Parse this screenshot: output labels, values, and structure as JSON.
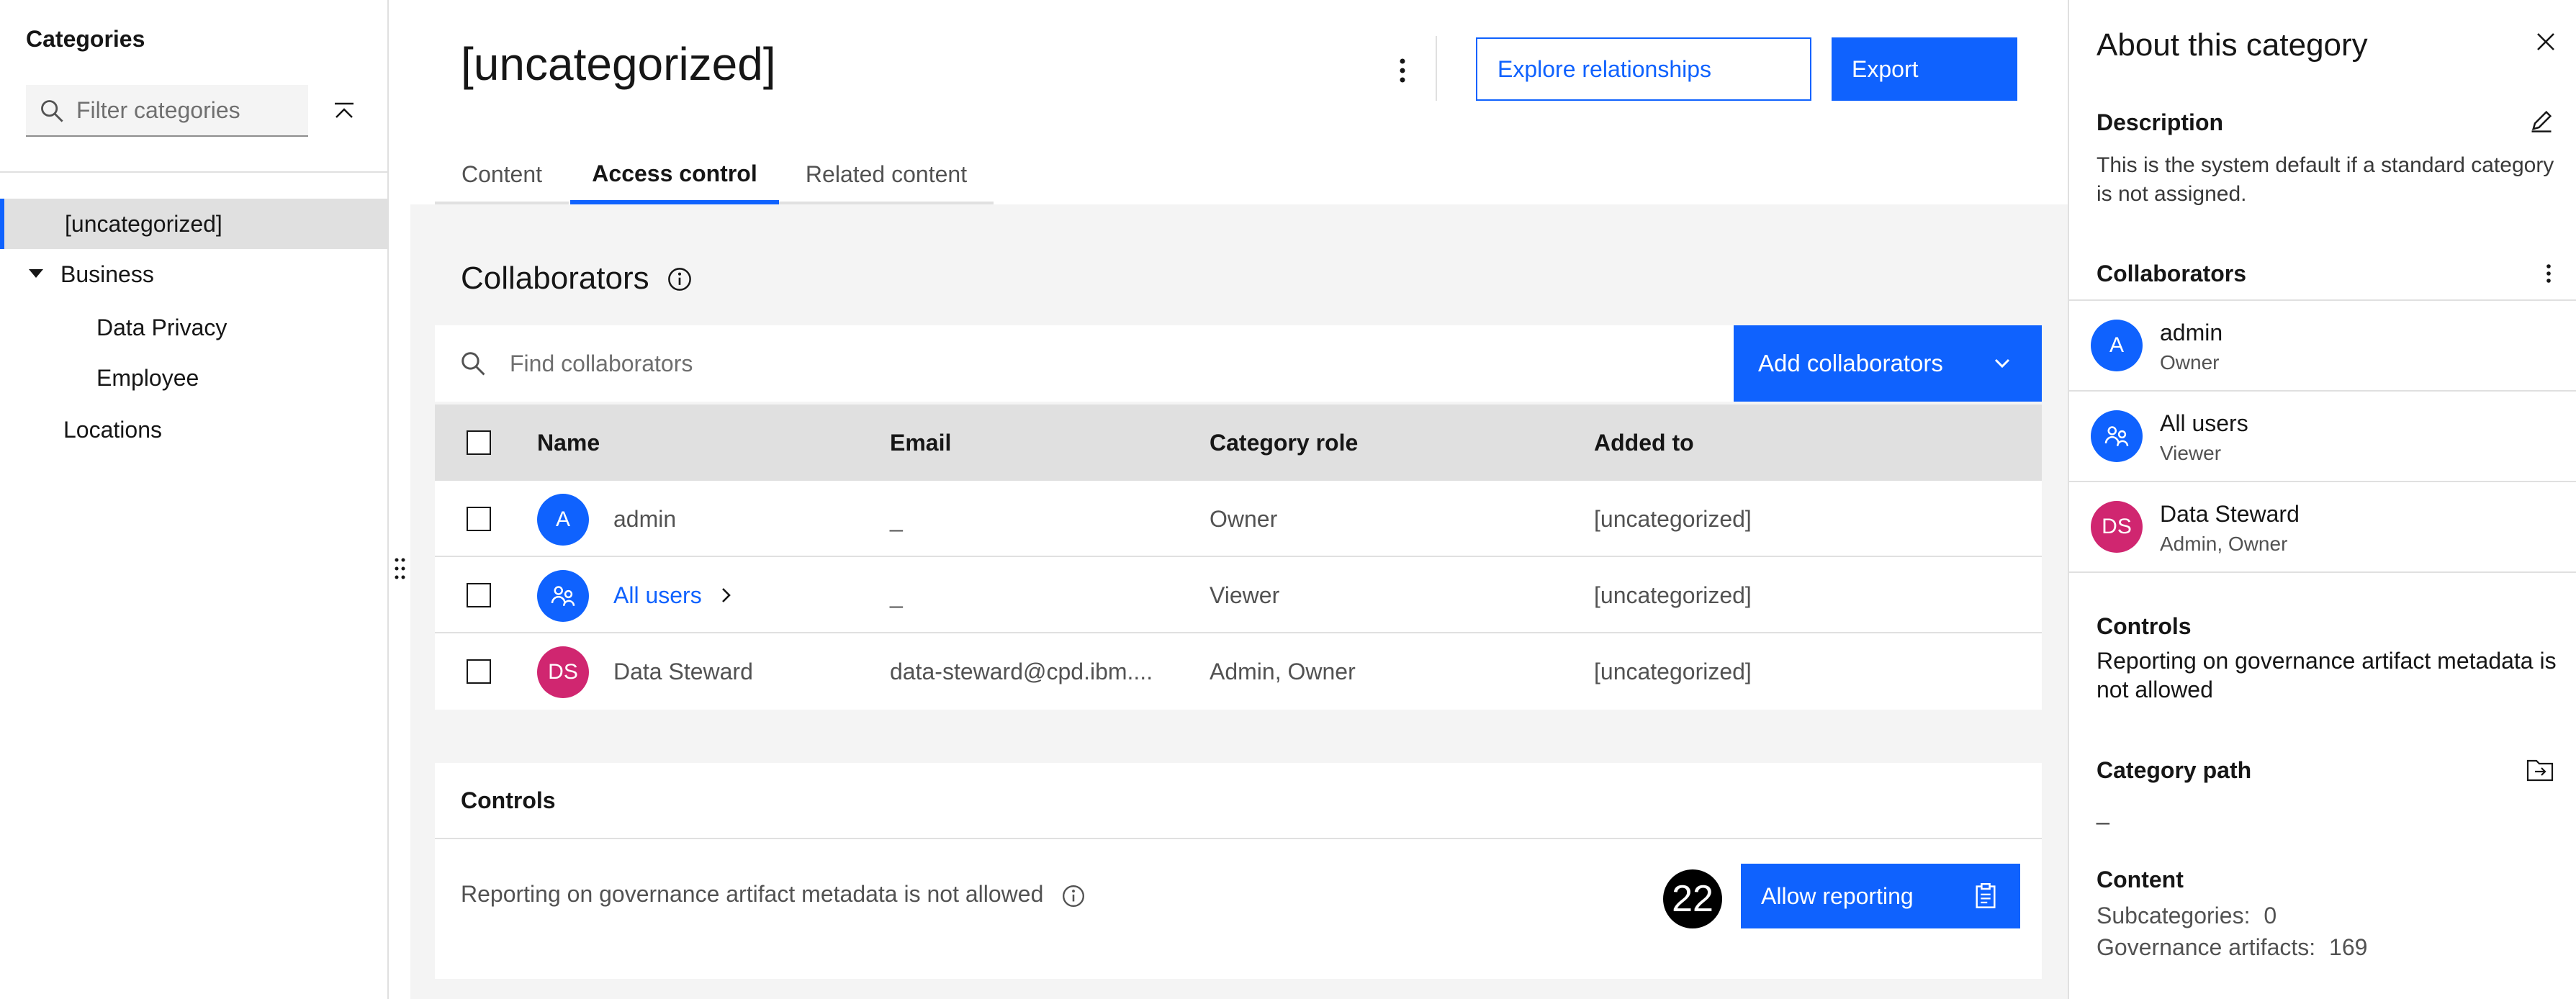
{
  "sidebar": {
    "title": "Categories",
    "filter_placeholder": "Filter categories",
    "tree": [
      {
        "label": "[uncategorized]",
        "selected": true
      },
      {
        "label": "Business",
        "expanded": true
      },
      {
        "label": "Data Privacy"
      },
      {
        "label": "Employee"
      },
      {
        "label": "Locations"
      }
    ]
  },
  "header": {
    "title": "[uncategorized]",
    "explore_label": "Explore relationships",
    "export_label": "Export"
  },
  "tabs": [
    {
      "label": "Content",
      "active": false
    },
    {
      "label": "Access control",
      "active": true
    },
    {
      "label": "Related content",
      "active": false
    }
  ],
  "collaborators": {
    "title": "Collaborators",
    "search_placeholder": "Find collaborators",
    "add_label": "Add collaborators",
    "columns": [
      "Name",
      "Email",
      "Category role",
      "Added to"
    ],
    "rows": [
      {
        "initials": "A",
        "name": "admin",
        "email": "_",
        "role": "Owner",
        "added_to": "[uncategorized]",
        "avatar_color": "#0f62fe",
        "is_link": false
      },
      {
        "initials": "",
        "name": "All users",
        "email": "_",
        "role": "Viewer",
        "added_to": "[uncategorized]",
        "avatar_color": "#0f62fe",
        "is_link": true
      },
      {
        "initials": "DS",
        "name": "Data Steward",
        "email": "data-steward@cpd.ibm....",
        "role": "Admin, Owner",
        "added_to": "[uncategorized]",
        "avatar_color": "#d02670",
        "is_link": false
      }
    ]
  },
  "controls": {
    "title": "Controls",
    "text": "Reporting on governance artifact metadata is not allowed",
    "badge": "22",
    "allow_label": "Allow reporting"
  },
  "panel": {
    "title": "About this category",
    "description_heading": "Description",
    "description_text": "This is the system default if a standard category is not assigned.",
    "collaborators_heading": "Collaborators",
    "collaborators": [
      {
        "initials": "A",
        "name": "admin",
        "role": "Owner",
        "avatar_color": "#0f62fe"
      },
      {
        "initials": "",
        "name": "All users",
        "role": "Viewer",
        "avatar_color": "#0f62fe"
      },
      {
        "initials": "DS",
        "name": "Data Steward",
        "role": "Admin, Owner",
        "avatar_color": "#d02670"
      }
    ],
    "controls_heading": "Controls",
    "controls_text": "Reporting on governance artifact metadata is not allowed",
    "path_heading": "Category path",
    "path_value": "_",
    "content_heading": "Content",
    "subcategories_label": "Subcategories:",
    "subcategories_value": "0",
    "artifacts_label": "Governance artifacts:",
    "artifacts_value": "169"
  },
  "colors": {
    "accent": "#0f62fe",
    "magenta": "#d02670",
    "surface": "#f4f4f4"
  }
}
